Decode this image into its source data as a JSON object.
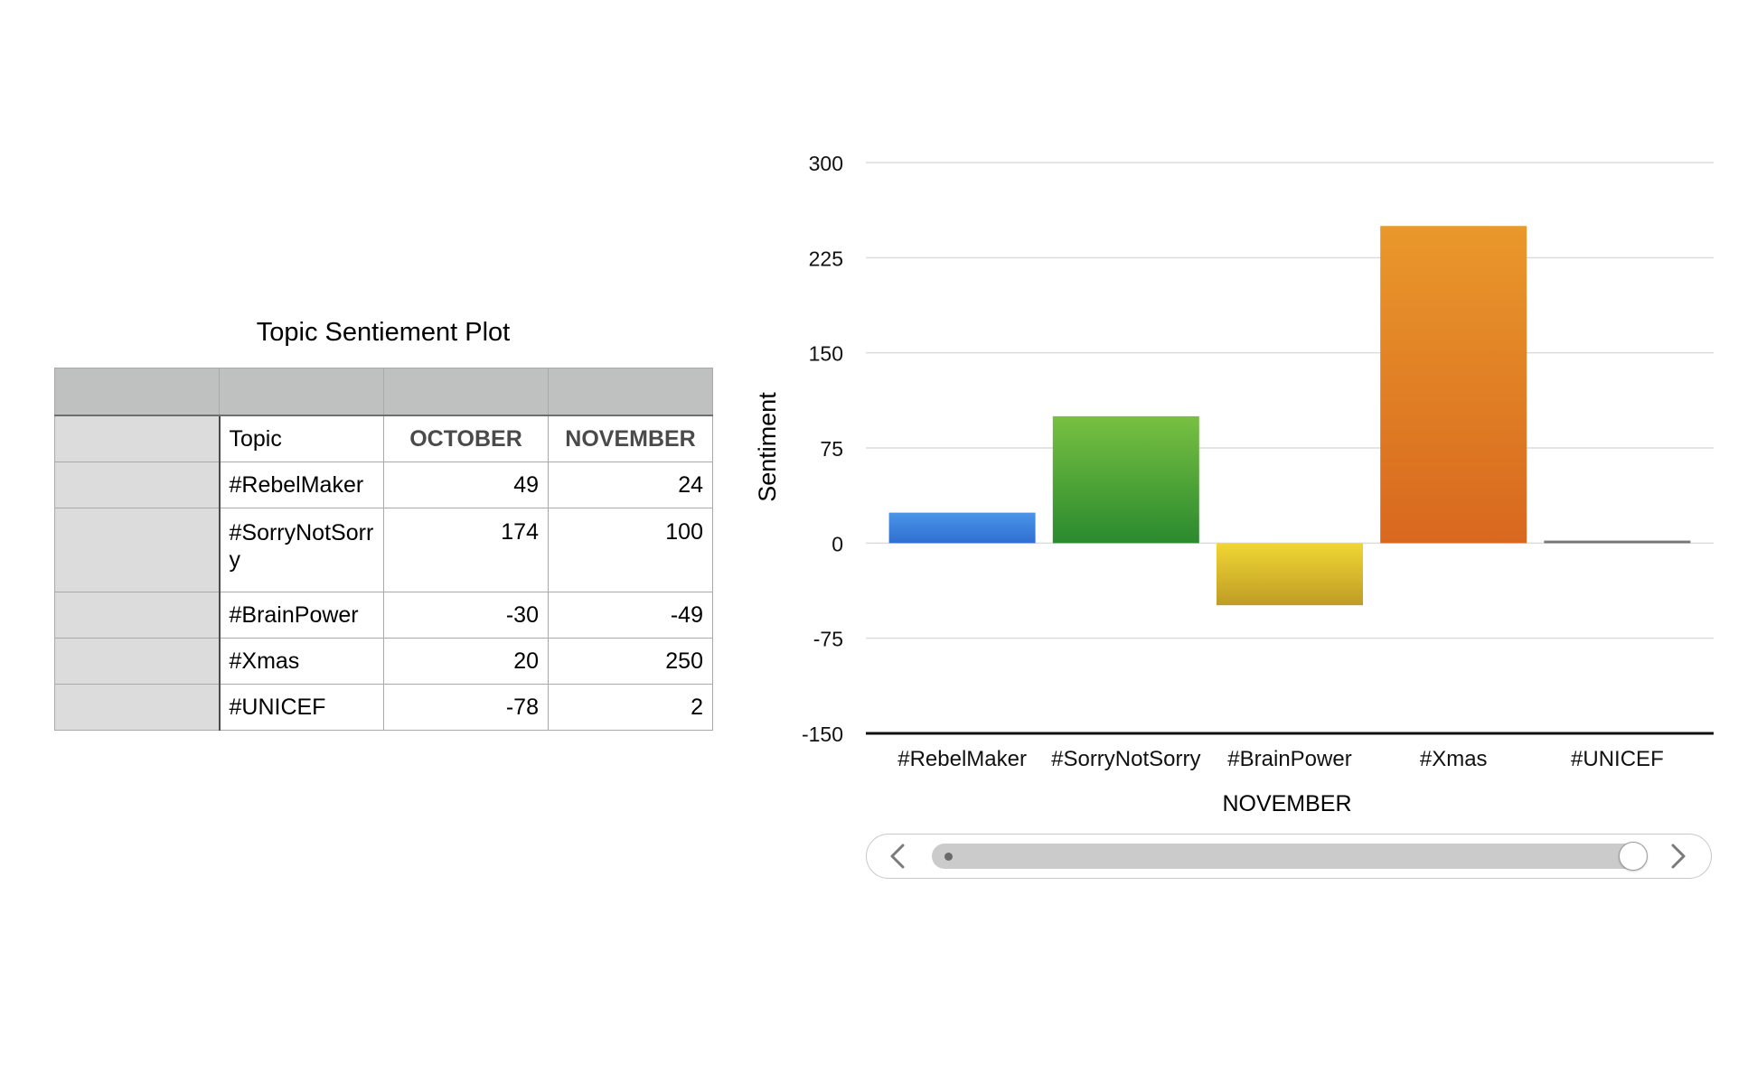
{
  "table": {
    "title": "Topic Sentiement Plot",
    "header_row": [
      "Topic",
      "OCTOBER",
      "NOVEMBER"
    ],
    "rows": [
      {
        "topic": "#RebelMaker",
        "october": "49",
        "november": "24"
      },
      {
        "topic": "#SorryNotSorry",
        "october": "174",
        "november": "100"
      },
      {
        "topic": "#BrainPower",
        "october": "-30",
        "november": "-49"
      },
      {
        "topic": "#Xmas",
        "october": "20",
        "november": "250"
      },
      {
        "topic": "#UNICEF",
        "october": "-78",
        "november": "2"
      }
    ]
  },
  "chart_data": {
    "type": "bar",
    "categories": [
      "#RebelMaker",
      "#SorryNotSorry",
      "#BrainPower",
      "#Xmas",
      "#UNICEF"
    ],
    "values": [
      24,
      100,
      -49,
      250,
      2
    ],
    "xlabel": "NOVEMBER",
    "ylabel": "Sentiment",
    "ylim": [
      -150,
      300
    ],
    "yticks": [
      "300",
      "225",
      "150",
      "75",
      "0",
      "-75",
      "-150"
    ],
    "bar_colors": [
      [
        "#4a95e8",
        "#2f6fd0"
      ],
      [
        "#78c042",
        "#2a8a2e"
      ],
      [
        "#f0d634",
        "#bf9c26"
      ],
      [
        "#e9982b",
        "#d8681f"
      ],
      [
        "#888888",
        "#666666"
      ]
    ],
    "grid": true
  },
  "scrollbar": {
    "left_arrow_icon": "chevron-left-icon",
    "right_arrow_icon": "chevron-right-icon"
  }
}
